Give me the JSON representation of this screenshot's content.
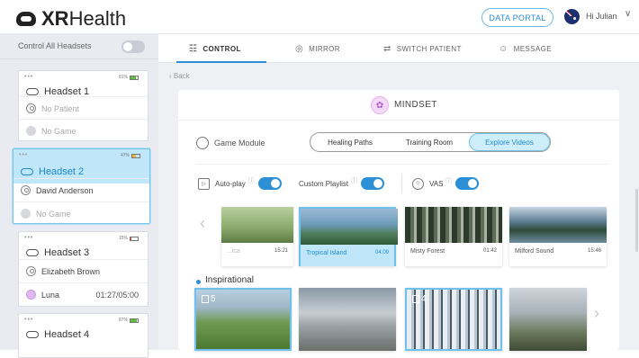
{
  "header": {
    "brand_xr": "XR",
    "brand_health": "Health",
    "portal_label": "DATA PORTAL",
    "greeting": "Hi Julian",
    "chevron": "∨"
  },
  "sidebar": {
    "control_all_label": "Control All Headsets",
    "cards": [
      {
        "dots": "•••",
        "battery": "81%",
        "name": "Headset 1",
        "patient": "No Patient",
        "game": "No Game",
        "battery_level": 0.81
      },
      {
        "dots": "•••",
        "battery": "47%",
        "name": "Headset 2",
        "patient": "David Anderson",
        "game": "No Game",
        "battery_level": 0.47
      },
      {
        "dots": "•••",
        "battery": "15%",
        "name": "Headset 3",
        "patient": "Elizabeth Brown",
        "game": "Luna",
        "time": "01:27/05:00",
        "battery_level": 0.15
      },
      {
        "dots": "•••",
        "battery": "87%",
        "name": "Headset 4",
        "battery_level": 0.87
      }
    ]
  },
  "tabs": [
    {
      "label": "CONTROL",
      "icon": "sliders-icon",
      "glyph": "☷"
    },
    {
      "label": "MIRROR",
      "icon": "eye-icon",
      "glyph": "◎"
    },
    {
      "label": "SWITCH PATIENT",
      "icon": "swap-icon",
      "glyph": "⇄"
    },
    {
      "label": "MESSAGE",
      "icon": "chat-icon",
      "glyph": "☺"
    }
  ],
  "back_label": "‹  Back",
  "panel": {
    "title": "MINDSET",
    "game_module_label": "Game Module",
    "segments": [
      "Healing Paths",
      "Training Room",
      "Explore Videos"
    ],
    "options": {
      "autoplay": "Auto-play",
      "playlist": "Custom Playlist",
      "vas": "VAS",
      "info": "ⓘ"
    },
    "videos": [
      {
        "title": "...ica",
        "duration": "15:21"
      },
      {
        "title": "Tropical Island",
        "duration": "04:09"
      },
      {
        "title": "Misty Forest",
        "duration": "01:42"
      },
      {
        "title": "Milford Sound",
        "duration": "15:46"
      }
    ],
    "section_label": "Inspirational",
    "insp_badges": [
      "5",
      "4"
    ],
    "arrow_left": "‹",
    "arrow_right": "›"
  }
}
